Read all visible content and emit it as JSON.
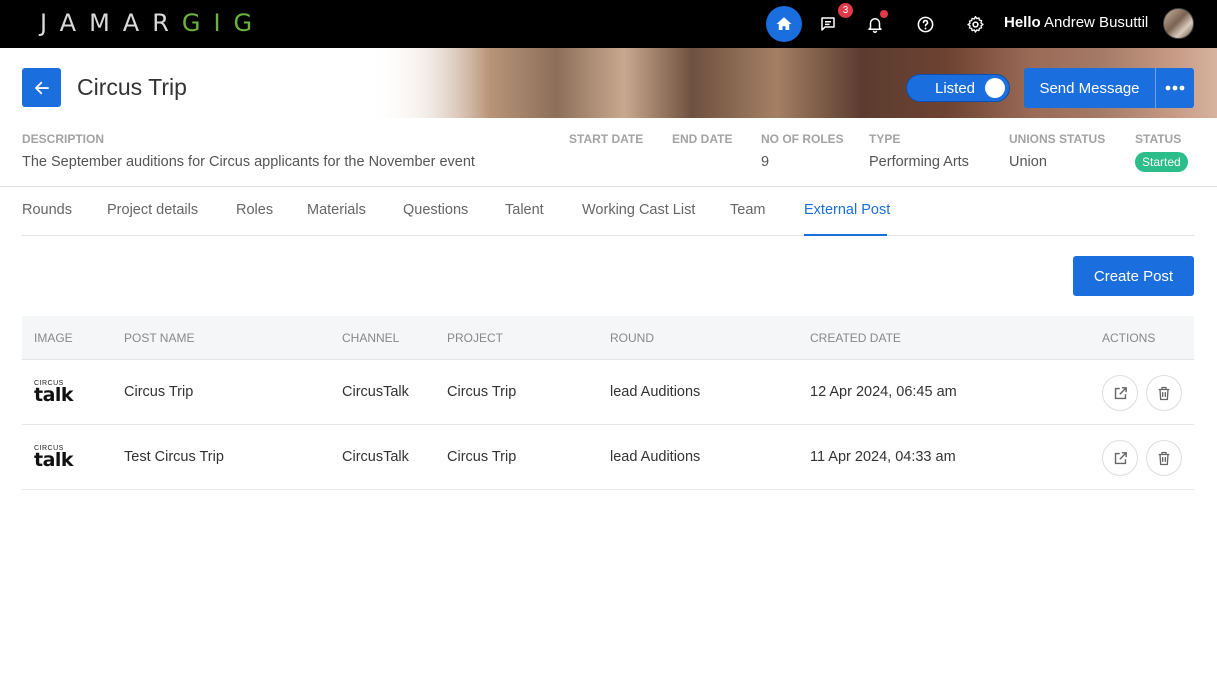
{
  "nav": {
    "logo_part1": "JAMAR",
    "logo_part2": "GIG",
    "messages_count": "3",
    "greeting": "Hello",
    "user_name": "Andrew Busuttil"
  },
  "header": {
    "title": "Circus Trip",
    "listed_label": "Listed",
    "send_message_label": "Send Message"
  },
  "meta": {
    "description_label": "DESCRIPTION",
    "description_value": "The September auditions for Circus applicants for the November event",
    "start_date_label": "START DATE",
    "end_date_label": "END DATE",
    "roles_label": "NO OF ROLES",
    "roles_value": "9",
    "type_label": "TYPE",
    "type_value": "Performing Arts",
    "unions_label": "UNIONS STATUS",
    "unions_value": "Union",
    "status_label": "STATUS",
    "status_value": "Started"
  },
  "tabs": [
    {
      "label": "Rounds"
    },
    {
      "label": "Project details"
    },
    {
      "label": "Roles"
    },
    {
      "label": "Materials"
    },
    {
      "label": "Questions"
    },
    {
      "label": "Talent"
    },
    {
      "label": "Working Cast List"
    },
    {
      "label": "Team"
    },
    {
      "label": "External Post"
    }
  ],
  "create_post_label": "Create Post",
  "table": {
    "columns": [
      "IMAGE",
      "POST NAME",
      "CHANNEL",
      "PROJECT",
      "ROUND",
      "CREATED DATE",
      "ACTIONS"
    ],
    "thumb_small": "CIRCUS",
    "thumb_big": "talk",
    "rows": [
      {
        "post_name": "Circus Trip",
        "channel": "CircusTalk",
        "project": "Circus Trip",
        "round": "lead Auditions",
        "created": "12 Apr 2024, 06:45 am"
      },
      {
        "post_name": "Test Circus Trip",
        "channel": "CircusTalk",
        "project": "Circus Trip",
        "round": "lead Auditions",
        "created": "11 Apr 2024, 04:33 am"
      }
    ]
  },
  "colors": {
    "accent": "#1b6ede",
    "status_green": "#2bbd8a",
    "alert_red": "#e0394a",
    "logo_green": "#6bb33a"
  }
}
